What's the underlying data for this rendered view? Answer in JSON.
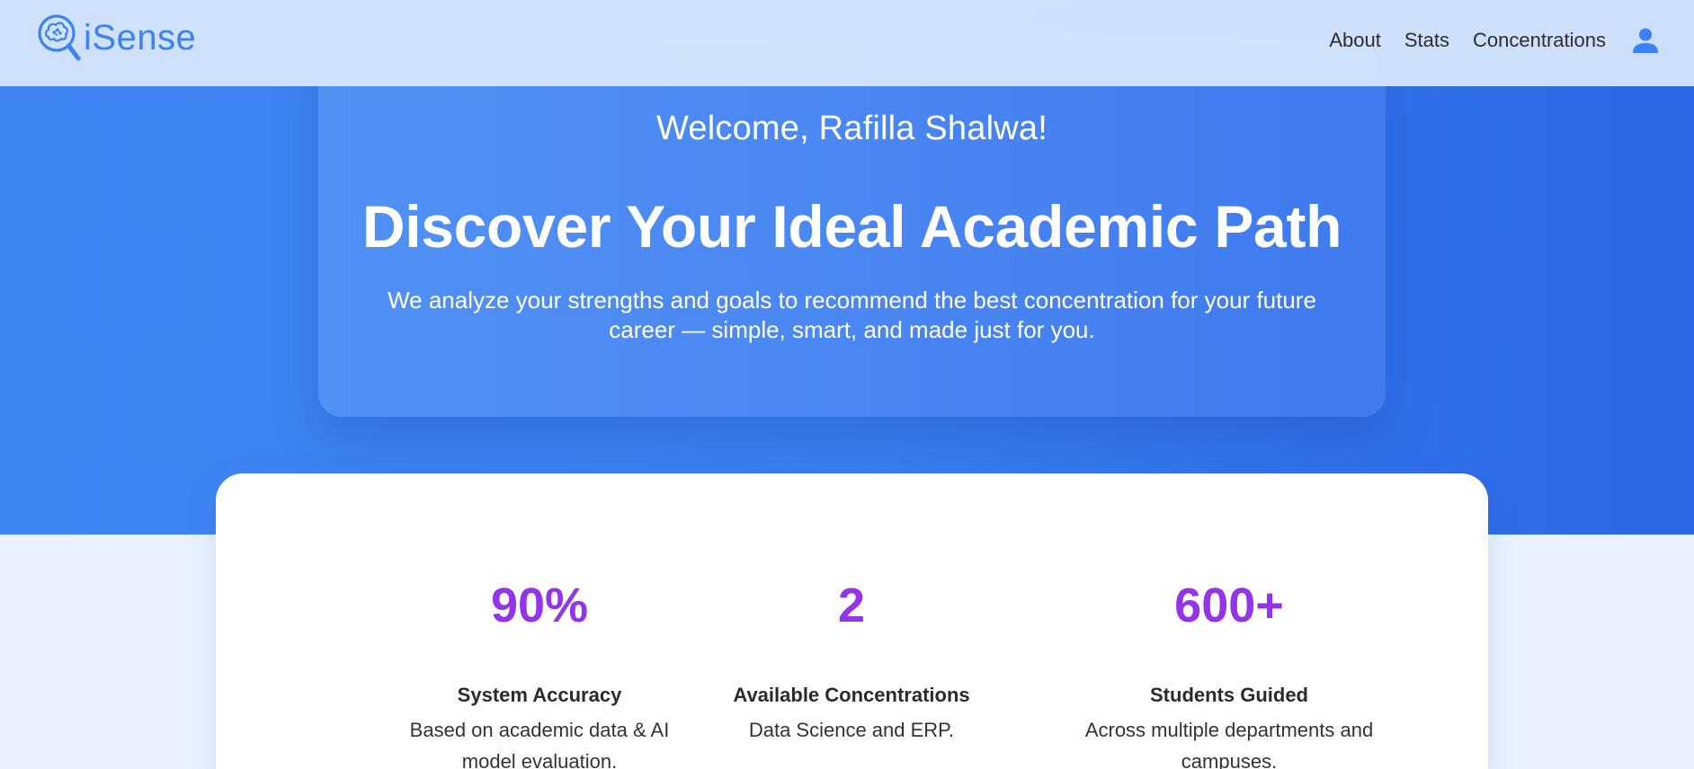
{
  "brand": {
    "name": "iSense",
    "accent": "#3b82f6"
  },
  "nav": {
    "links": [
      "About",
      "Stats",
      "Concentrations"
    ],
    "user_icon": "user-icon"
  },
  "hero": {
    "welcome": "Welcome, Rafilla Shalwa!",
    "headline": "Discover Your Ideal Academic Path",
    "subtext": "We analyze your strengths and goals to recommend the best concentration for your future career — simple, smart, and made just for you."
  },
  "stats": [
    {
      "value": "90%",
      "title": "System Accuracy",
      "description": "Based on academic data & AI model evaluation."
    },
    {
      "value": "2",
      "title": "Available Concentrations",
      "description": "Data Science and ERP."
    },
    {
      "value": "600+",
      "title": "Students Guided",
      "description": "Across multiple departments and campuses."
    }
  ],
  "colors": {
    "hero_blue": "#3b80f1",
    "stat_value": "#9333ea",
    "page_bg": "#e8f1fd"
  }
}
